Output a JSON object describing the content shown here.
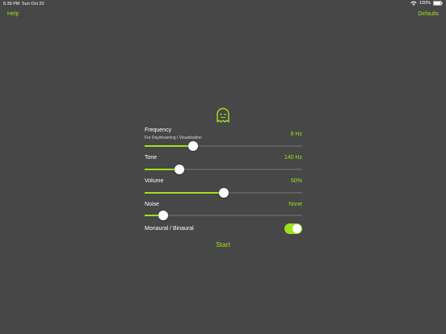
{
  "status_bar": {
    "time": "6:39 PM",
    "date": "Sun Oct 20",
    "battery": "100%"
  },
  "nav": {
    "help": "Help",
    "defaults": "Defaults"
  },
  "accent_color": "#9ee01e",
  "background_color": "#474747",
  "icon": "ghost-icon",
  "sliders": [
    {
      "label": "Frequency",
      "sublabel": "For Daydreaming / Visualisation",
      "value": "8 Hz",
      "level": 0.31
    },
    {
      "label": "Tone",
      "value": "140 Hz",
      "level": 0.22
    },
    {
      "label": "Volume",
      "value": "50%",
      "level": 0.5
    },
    {
      "label": "Noise",
      "value": "None",
      "level": 0.12
    }
  ],
  "toggle": {
    "label": "Monaural / Binaural",
    "on": true
  },
  "start_label": "Start"
}
